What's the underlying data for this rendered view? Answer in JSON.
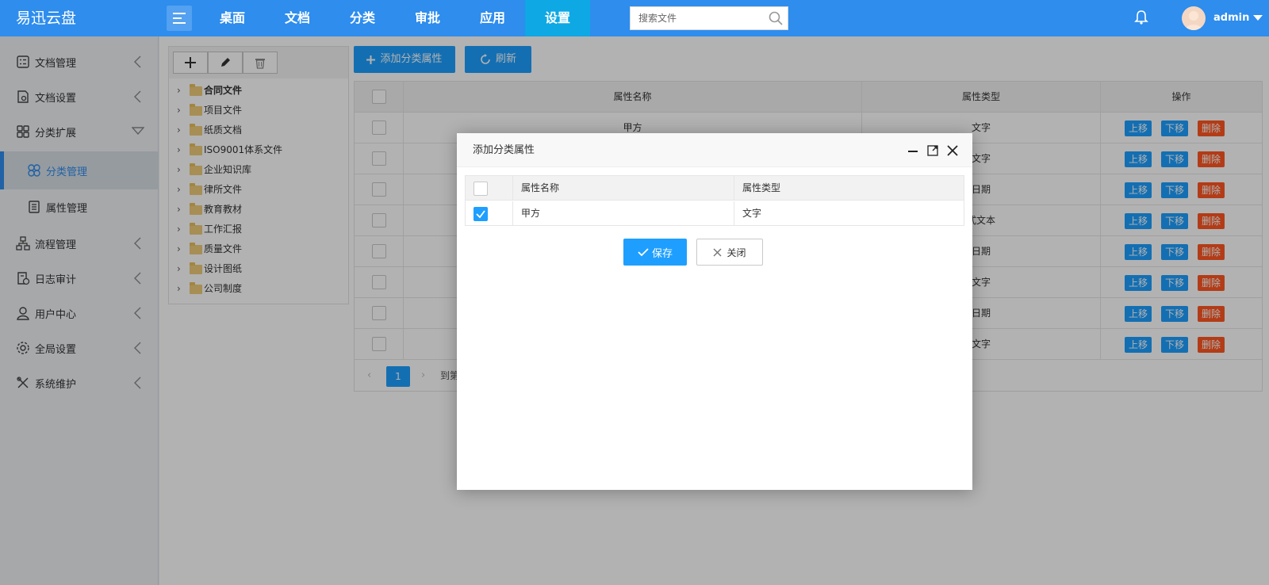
{
  "header": {
    "brand": "易迅云盘",
    "nav": [
      "桌面",
      "文档",
      "分类",
      "审批",
      "应用",
      "设置"
    ],
    "active_nav": "设置",
    "search_placeholder": "搜索文件",
    "user": "admin",
    "accent": "#2e8ded",
    "active_tab_color": "#0ea8e4"
  },
  "sidebar": {
    "items": [
      {
        "label": "文档管理",
        "icon": "checklist-icon"
      },
      {
        "label": "文档设置",
        "icon": "doc-settings-icon"
      },
      {
        "label": "分类扩展",
        "icon": "grid-icon"
      },
      {
        "label": "分类管理",
        "icon": "clover-icon"
      },
      {
        "label": "属性管理",
        "icon": "list-icon"
      },
      {
        "label": "流程管理",
        "icon": "flow-icon"
      },
      {
        "label": "日志审计",
        "icon": "log-icon"
      },
      {
        "label": "用户中心",
        "icon": "user-icon"
      },
      {
        "label": "全局设置",
        "icon": "gear-icon"
      },
      {
        "label": "系统维护",
        "icon": "tools-icon"
      }
    ],
    "active": "分类管理"
  },
  "tree": {
    "items": [
      "合同文件",
      "项目文件",
      "纸质文档",
      "ISO9001体系文件",
      "企业知识库",
      "律所文件",
      "教育教材",
      "工作汇报",
      "质量文件",
      "设计图纸",
      "公司制度"
    ]
  },
  "toolbar": {
    "add_label": "添加分类属性",
    "refresh_label": "刷新"
  },
  "table": {
    "headers": [
      "属性名称",
      "属性类型",
      "操作"
    ],
    "rows": [
      {
        "name": "甲方",
        "type": "文字"
      },
      {
        "name": "",
        "type": "文字"
      },
      {
        "name": "",
        "type": "日期"
      },
      {
        "name": "",
        "type": "式文本"
      },
      {
        "name": "",
        "type": "日期"
      },
      {
        "name": "",
        "type": "文字"
      },
      {
        "name": "",
        "type": "日期"
      },
      {
        "name": "",
        "type": "文字"
      }
    ],
    "ops": [
      "上移",
      "下移",
      "删除"
    ],
    "page": "1",
    "goto_text": "到第"
  },
  "modal": {
    "title": "添加分类属性",
    "headers": [
      "属性名称",
      "属性类型"
    ],
    "rows": [
      {
        "name": "甲方",
        "type": "文字",
        "checked": true
      }
    ],
    "save_label": "保存",
    "close_label": "关闭"
  }
}
